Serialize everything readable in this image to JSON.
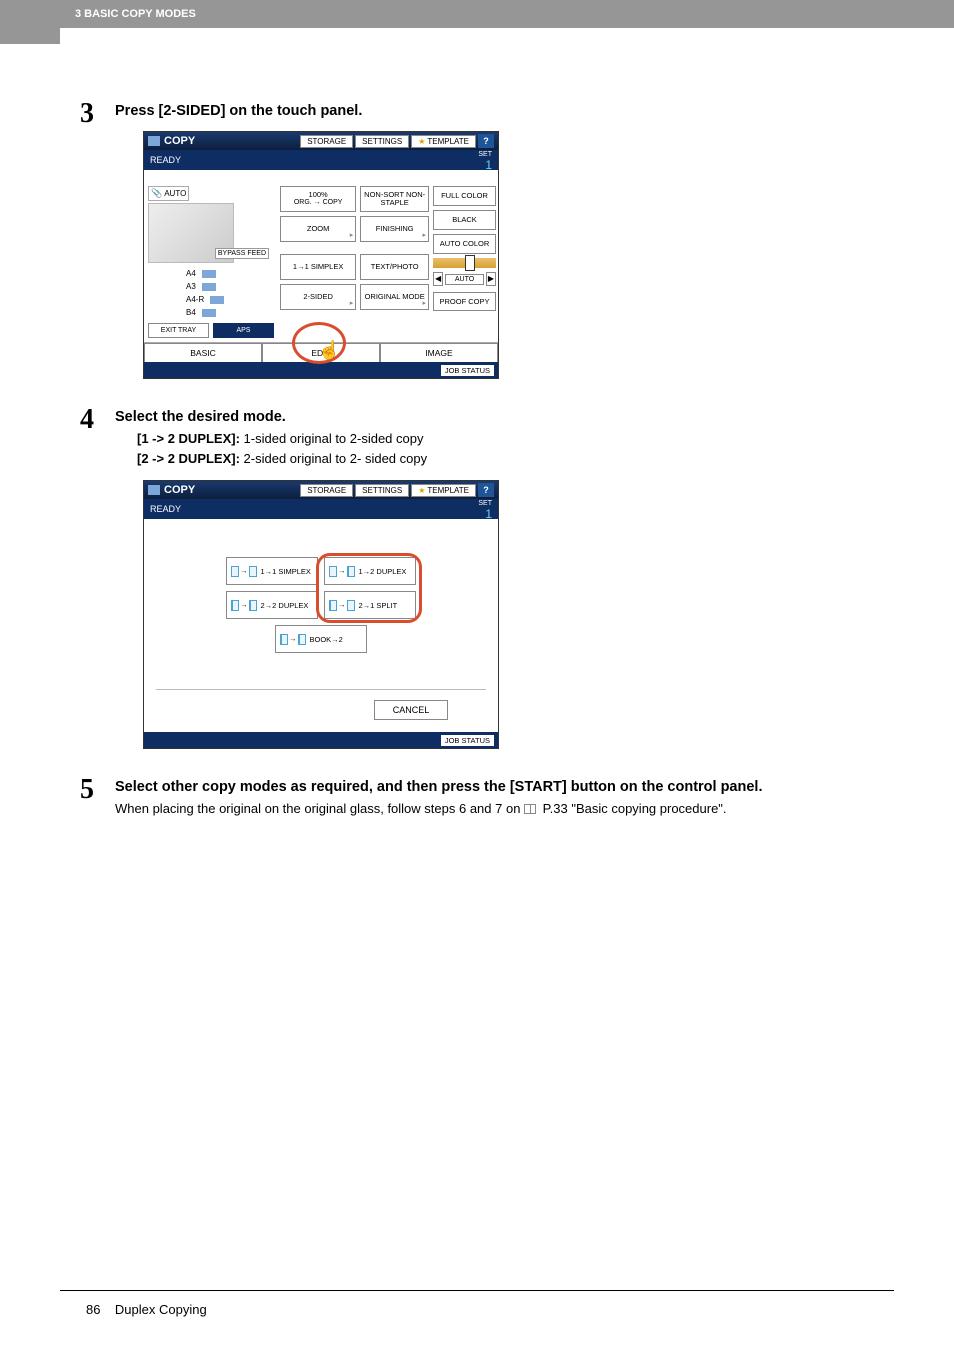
{
  "header": "3 BASIC COPY MODES",
  "steps": {
    "s3": {
      "num": "3",
      "title": "Press [2-SIDED] on the touch panel."
    },
    "s4": {
      "num": "4",
      "title": "Select the desired mode.",
      "d1a": "[1 -> 2 DUPLEX]:",
      "d1b": " 1-sided original to 2-sided copy",
      "d2a": "[2 -> 2 DUPLEX]:",
      "d2b": " 2-sided original to 2- sided copy"
    },
    "s5": {
      "num": "5",
      "title": "Select other copy modes as required, and then press the [START] button on the control panel.",
      "body_a": "When placing the original on the original glass, follow steps 6 and 7 on ",
      "body_b": " P.33 \"Basic copying procedure\"."
    }
  },
  "panel": {
    "title": "COPY",
    "storage": "STORAGE",
    "settings": "SETTINGS",
    "template": "TEMPLATE",
    "help": "?",
    "ready": "READY",
    "set": "SET",
    "count": "1",
    "auto": "AUTO",
    "bypass": "BYPASS FEED",
    "sizes": {
      "a4": "A4",
      "a3": "A3",
      "a4r": "A4-R",
      "b4": "B4",
      "a4b": "A4"
    },
    "exit": "EXIT TRAY",
    "aps": "APS",
    "ratio": "100%",
    "orgcopy": "ORG. → COPY",
    "zoom": "ZOOM",
    "simplex": "1→1 SIMPLEX",
    "twosided": "2-SIDED",
    "nonsort": "NON-SORT NON-STAPLE",
    "finishing": "FINISHING",
    "textphoto": "TEXT/PHOTO",
    "origmode": "ORIGINAL MODE",
    "fullcolor": "FULL COLOR",
    "black": "BLACK",
    "autocolor": "AUTO COLOR",
    "autoDensity": "AUTO",
    "proof": "PROOF COPY",
    "tabs": {
      "basic": "BASIC",
      "edit": "EDIT",
      "image": "IMAGE"
    },
    "jobstatus": "JOB STATUS"
  },
  "duplex": {
    "b11": "1→1 SIMPLEX",
    "b12": "1→2 DUPLEX",
    "b22": "2→2 DUPLEX",
    "b21": "2→1 SPLIT",
    "book": "BOOK→2",
    "cancel": "CANCEL"
  },
  "footer": {
    "page": "86",
    "section": "Duplex Copying"
  }
}
